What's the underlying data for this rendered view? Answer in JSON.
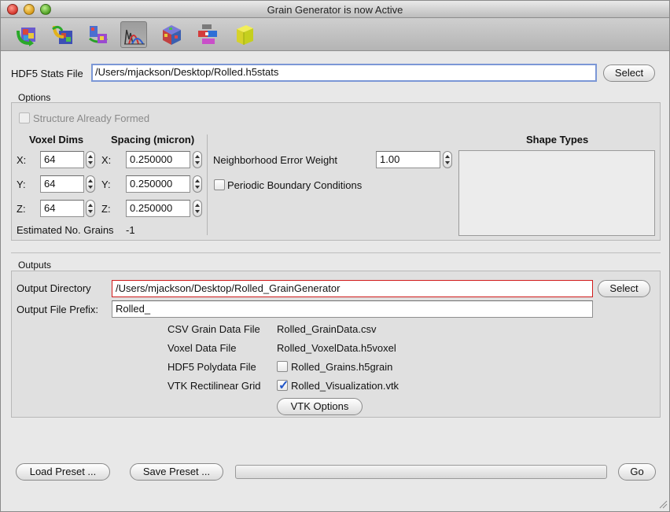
{
  "window": {
    "title": "Grain Generator is now Active"
  },
  "toolbar": {
    "items": [
      {
        "icon": "grain-generator-icon"
      },
      {
        "icon": "reconstruction-icon"
      },
      {
        "icon": "surface-mesh-icon"
      },
      {
        "icon": "statistics-icon",
        "active": true
      },
      {
        "icon": "microstructure-cube-icon"
      },
      {
        "icon": "ebsd-conversion-icon"
      },
      {
        "icon": "rendering-cube-icon"
      }
    ]
  },
  "stats_file": {
    "label": "HDF5 Stats File",
    "value": "/Users/mjackson/Desktop/Rolled.h5stats",
    "select_label": "Select"
  },
  "options": {
    "title": "Options",
    "structure_formed_label": "Structure Already Formed",
    "structure_formed_checked": false,
    "voxel_dims_header": "Voxel Dims",
    "spacing_header": "Spacing (micron)",
    "axes": [
      "X:",
      "Y:",
      "Z:"
    ],
    "voxel_dims": [
      "64",
      "64",
      "64"
    ],
    "spacing": [
      "0.250000",
      "0.250000",
      "0.250000"
    ],
    "estimated_label": "Estimated No. Grains",
    "estimated_value": "-1",
    "neighborhood_label": "Neighborhood Error Weight",
    "neighborhood_value": "1.00",
    "periodic_label": "Periodic Boundary Conditions",
    "periodic_checked": false,
    "shape_types_header": "Shape Types"
  },
  "outputs": {
    "title": "Outputs",
    "output_dir_label": "Output Directory",
    "output_dir_value": "/Users/mjackson/Desktop/Rolled_GrainGenerator",
    "select_label": "Select",
    "prefix_label": "Output File Prefix:",
    "prefix_value": "Rolled_",
    "files": [
      {
        "label": "CSV Grain Data File",
        "value": "Rolled_GrainData.csv",
        "has_checkbox": false
      },
      {
        "label": "Voxel Data File",
        "value": "Rolled_VoxelData.h5voxel",
        "has_checkbox": false
      },
      {
        "label": "HDF5 Polydata File",
        "value": "Rolled_Grains.h5grain",
        "has_checkbox": true,
        "checked": false
      },
      {
        "label": "VTK Rectilinear Grid",
        "value": "Rolled_Visualization.vtk",
        "has_checkbox": true,
        "checked": true
      }
    ],
    "vtk_options_label": "VTK Options"
  },
  "footer": {
    "load_preset_label": "Load Preset ...",
    "save_preset_label": "Save Preset ...",
    "progress": 0,
    "go_label": "Go"
  },
  "colors": {
    "focus_ring": "#7b97d6",
    "error_border": "#d11a1a",
    "checkmark": "#2357c9"
  }
}
